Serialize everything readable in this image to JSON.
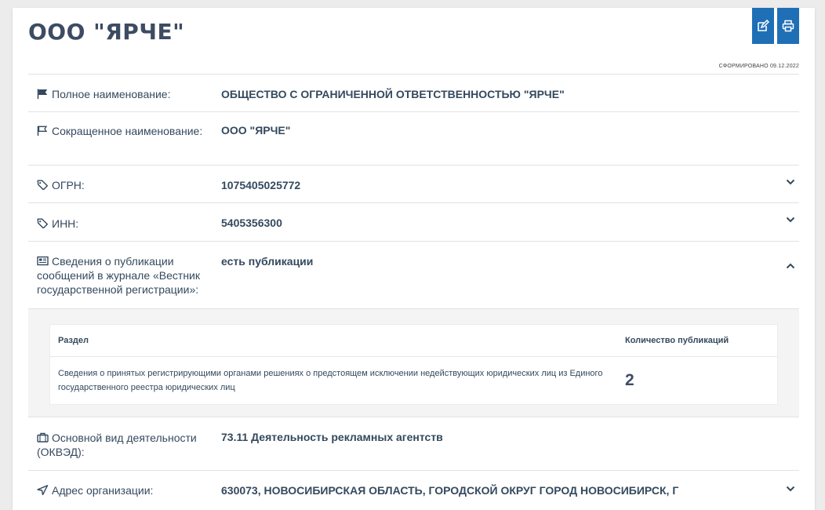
{
  "header": {
    "title": "ООО \"ЯРЧЕ\"",
    "generated": "СФОРМИРОВАНО 09.12.2022"
  },
  "toolbar": {
    "edit_icon": "edit-icon",
    "print_icon": "print-icon"
  },
  "rows": [
    {
      "icon": "flag-filled-icon",
      "label": "Полное наименование:",
      "value": "ОБЩЕСТВО С ОГРАНИЧЕННОЙ ОТВЕТСТВЕННОСТЬЮ \"ЯРЧЕ\""
    },
    {
      "icon": "flag-outline-icon",
      "label": "Сокращенное наименование:",
      "value": "ООО \"ЯРЧЕ\""
    },
    {
      "icon": "tag-icon",
      "label": "ОГРН:",
      "value": "1075405025772",
      "toggle": "chevron-down-icon"
    },
    {
      "icon": "tag-icon",
      "label": "ИНН:",
      "value": "5405356300",
      "toggle": "chevron-down-icon"
    },
    {
      "icon": "newspaper-icon",
      "label": "Сведения о публикации сообщений в журнале «Вестник государственной регистрации»:",
      "value": "есть публикации",
      "toggle": "chevron-up-icon"
    },
    {
      "icon": "briefcase-icon",
      "label": "Основной вид деятельности (ОКВЭД):",
      "value": "73.11 Деятельность рекламных агентств"
    },
    {
      "icon": "location-arrow-icon",
      "label": "Адрес организации:",
      "value": "630073, НОВОСИБИРСКАЯ ОБЛАСТЬ, ГОРОДСКОЙ ОКРУГ ГОРОД НОВОСИБИРСК, Г",
      "toggle": "chevron-down-icon"
    }
  ],
  "publications": {
    "headers": {
      "section": "Раздел",
      "count": "Количество публикаций"
    },
    "rows": [
      {
        "section": "Сведения о принятых регистрирующими органами решениях о предстоящем исключении недействующих юридических лиц из Единого государственного реестра юридических лиц",
        "count": "2"
      }
    ]
  },
  "colors": {
    "accent": "#1f6fb6",
    "text": "#34495e",
    "panel": "#f4f4f4"
  }
}
